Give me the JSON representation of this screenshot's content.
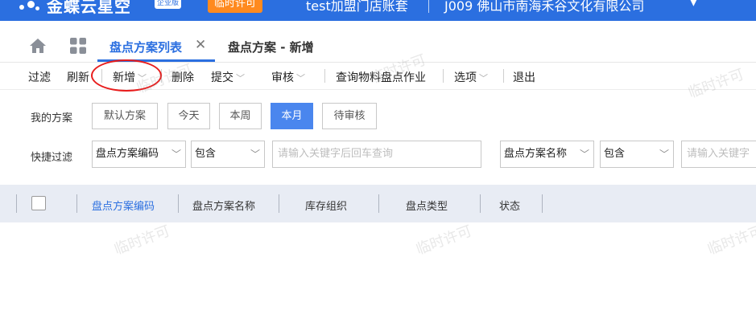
{
  "header": {
    "brand": "金蝶云星空",
    "edition": "企业版",
    "license_badge": "临时许可",
    "account": "test加盟门店账套",
    "organization": "J009 佛山市南海禾谷文化有限公司"
  },
  "tabs": [
    {
      "label": "盘点方案列表",
      "active": true
    },
    {
      "label": "盘点方案 - 新增",
      "active": false
    }
  ],
  "toolbar": {
    "filter": "过滤",
    "refresh": "刷新",
    "new": "新增",
    "delete": "删除",
    "submit": "提交",
    "audit": "审核",
    "query": "查询物料盘点作业",
    "options": "选项",
    "exit": "退出"
  },
  "filter": {
    "my_scheme_label": "我的方案",
    "schemes": [
      "默认方案",
      "今天",
      "本周",
      "本月",
      "待审核"
    ],
    "active_scheme": "本月",
    "quick_filter_label": "快捷过滤",
    "field1": "盘点方案编码",
    "op1": "包含",
    "placeholder1": "请输入关键字后回车查询",
    "field2": "盘点方案名称",
    "op2": "包含",
    "placeholder2": "请输入关键字"
  },
  "grid": {
    "columns": [
      "盘点方案编码",
      "盘点方案名称",
      "库存组织",
      "盘点类型",
      "状态"
    ]
  },
  "watermark": "临时许可",
  "colors": {
    "brand_blue": "#2b6fe0",
    "license_orange": "#ff8a1f",
    "active_pill": "#4a86ee",
    "annotation_red": "#e81c1c",
    "grid_header_bg": "#e8ecf4"
  }
}
